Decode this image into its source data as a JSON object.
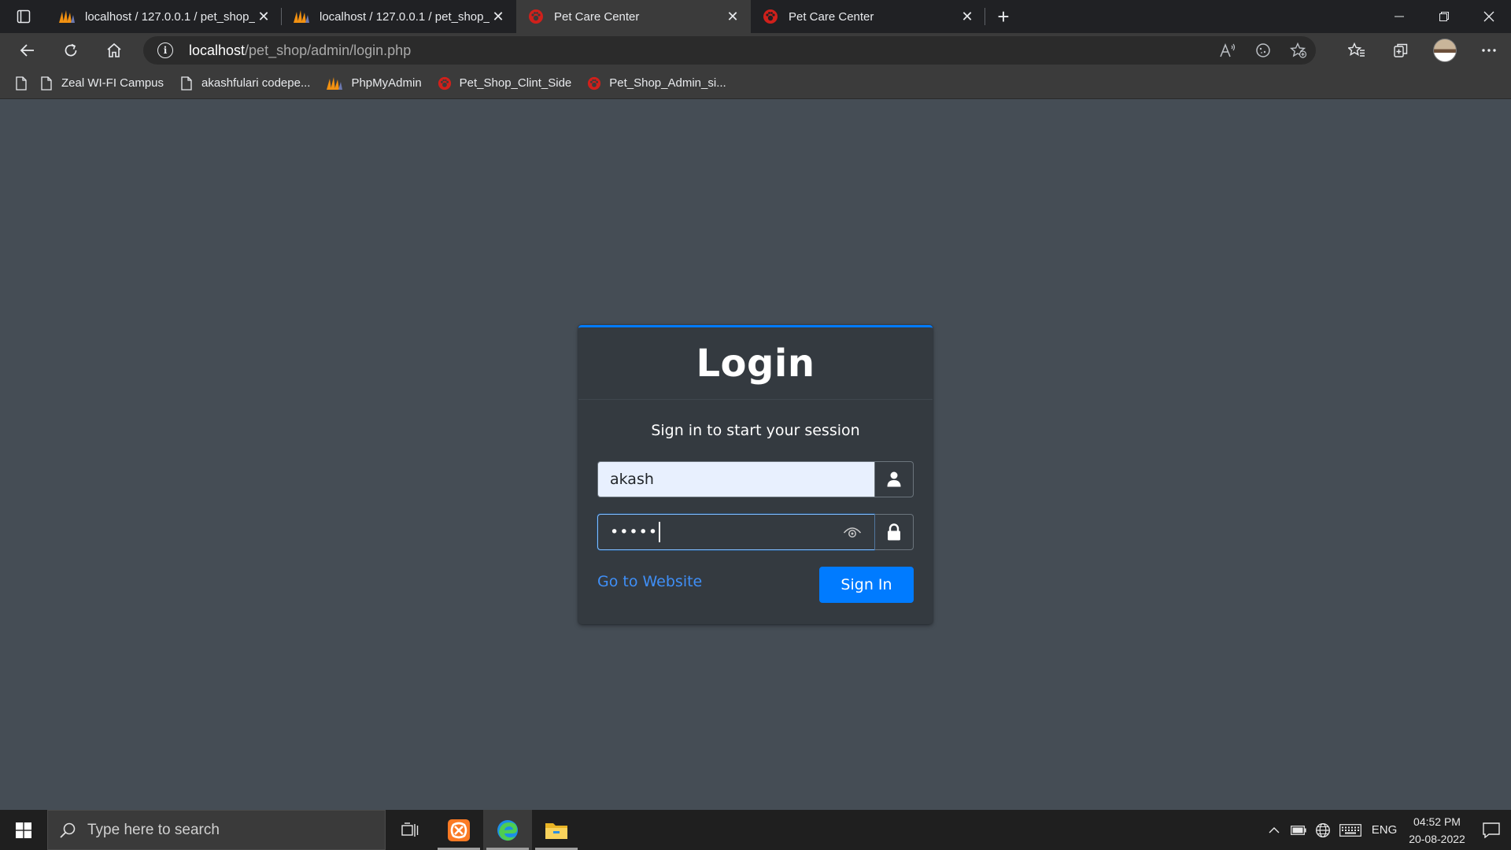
{
  "browser": {
    "tabs": [
      {
        "title": "localhost / 127.0.0.1 / pet_shop_",
        "icon": "phpmyadmin-icon",
        "active": false
      },
      {
        "title": "localhost / 127.0.0.1 / pet_shop_",
        "icon": "phpmyadmin-icon",
        "active": false
      },
      {
        "title": "Pet Care Center",
        "icon": "pet-care-icon",
        "active": true
      },
      {
        "title": "Pet Care Center",
        "icon": "pet-care-icon",
        "active": false
      }
    ],
    "address": {
      "host": "localhost",
      "path": "/pet_shop/admin/login.php"
    },
    "bookmarks": [
      {
        "label": "Zeal WI-FI Campus",
        "icon": "page-icon"
      },
      {
        "label": "akashfulari codepe...",
        "icon": "page-icon"
      },
      {
        "label": "PhpMyAdmin",
        "icon": "phpmyadmin-icon"
      },
      {
        "label": "Pet_Shop_Clint_Side",
        "icon": "pet-care-icon"
      },
      {
        "label": "Pet_Shop_Admin_si...",
        "icon": "pet-care-icon"
      }
    ]
  },
  "login": {
    "title": "Login",
    "subtitle": "Sign in to start your session",
    "username_value": "akash",
    "password_value": "•••••",
    "go_to_website": "Go to Website",
    "sign_in": "Sign In"
  },
  "taskbar": {
    "search_placeholder": "Type here to search",
    "language": "ENG",
    "time": "04:52 PM",
    "date": "20-08-2022"
  },
  "colors": {
    "page_bg": "#454d55",
    "card_bg": "#343a40",
    "accent": "#007bff",
    "link": "#3f8ff7"
  }
}
